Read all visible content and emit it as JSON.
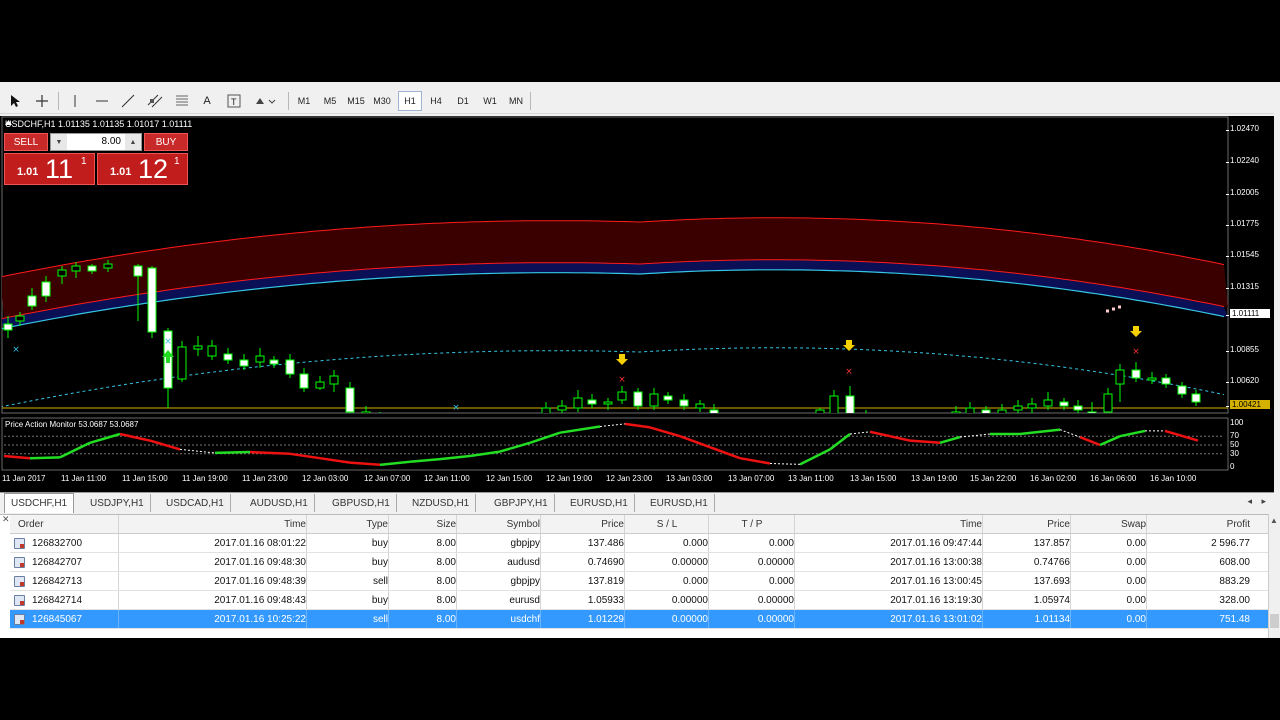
{
  "toolbar": {
    "timeframes": [
      "M1",
      "M5",
      "M15",
      "M30",
      "H1",
      "H4",
      "D1",
      "W1",
      "MN"
    ],
    "active_timeframe": "H1",
    "tools": [
      "cursor-icon",
      "crosshair-icon",
      "vertical-line-icon",
      "horizontal-line-icon",
      "trendline-icon",
      "channel-icon",
      "fibonacci-icon",
      "text-icon",
      "text-label-icon",
      "shapes-icon"
    ]
  },
  "chart": {
    "symbol_line": "USDCHF,H1  1.01135 1.01135 1.01017 1.01111",
    "indicator_title": "Price Action Monitor 53.0687 53.0687",
    "price_labels": [
      "1.02470",
      "1.02240",
      "1.02005",
      "1.01775",
      "1.01545",
      "1.01315",
      "1.01111",
      "1.00855",
      "1.00620",
      "1.00421"
    ],
    "current_price": "1.01111",
    "bid_line_price": "1.00421",
    "indicator_levels": [
      "100",
      "70",
      "50",
      "30",
      "0"
    ],
    "time_labels": [
      "11 Jan 2017",
      "11 Jan 11:00",
      "11 Jan 15:00",
      "11 Jan 19:00",
      "11 Jan 23:00",
      "12 Jan 03:00",
      "12 Jan 07:00",
      "12 Jan 11:00",
      "12 Jan 15:00",
      "12 Jan 19:00",
      "12 Jan 23:00",
      "13 Jan 03:00",
      "13 Jan 07:00",
      "13 Jan 11:00",
      "13 Jan 15:00",
      "13 Jan 19:00",
      "15 Jan 22:00",
      "16 Jan 02:00",
      "16 Jan 06:00",
      "16 Jan 10:00"
    ],
    "colors": {
      "up": "#00ff00",
      "down": "#ffffff",
      "band_fill": "#3a0000",
      "outer_band": "#ff1a1a",
      "inner_band": "#1a2aff",
      "mid_band": "#34c6e6",
      "osc_up": "#22dd22",
      "osc_down": "#ee1111"
    }
  },
  "oneclick": {
    "sell_label": "SELL",
    "buy_label": "BUY",
    "volume": "8.00",
    "sell_price_small": "1.01",
    "sell_price_big": "11",
    "sell_price_sup": "1",
    "buy_price_small": "1.01",
    "buy_price_big": "12",
    "buy_price_sup": "1"
  },
  "symbol_tabs": [
    "USDCHF,H1",
    "USDJPY,H1",
    "USDCAD,H1",
    "AUDUSD,H1",
    "GBPUSD,H1",
    "NZDUSD,H1",
    "GBPJPY,H1",
    "EURUSD,H1",
    "EURUSD,H1"
  ],
  "active_symbol_tab": "USDCHF,H1",
  "orders": {
    "headers": [
      "Order",
      "Time",
      "Type",
      "Size",
      "Symbol",
      "Price",
      "S / L",
      "T / P",
      "Time",
      "Price",
      "Swap",
      "Profit"
    ],
    "rows": [
      [
        "126832700",
        "2017.01.16 08:01:22",
        "buy",
        "8.00",
        "gbpjpy",
        "137.486",
        "0.000",
        "0.000",
        "2017.01.16 09:47:44",
        "137.857",
        "0.00",
        "2 596.77"
      ],
      [
        "126842707",
        "2017.01.16 09:48:30",
        "buy",
        "8.00",
        "audusd",
        "0.74690",
        "0.00000",
        "0.00000",
        "2017.01.16 13:00:38",
        "0.74766",
        "0.00",
        "608.00"
      ],
      [
        "126842713",
        "2017.01.16 09:48:39",
        "sell",
        "8.00",
        "gbpjpy",
        "137.819",
        "0.000",
        "0.000",
        "2017.01.16 13:00:45",
        "137.693",
        "0.00",
        "883.29"
      ],
      [
        "126842714",
        "2017.01.16 09:48:43",
        "buy",
        "8.00",
        "eurusd",
        "1.05933",
        "0.00000",
        "0.00000",
        "2017.01.16 13:19:30",
        "1.05974",
        "0.00",
        "328.00"
      ],
      [
        "126845067",
        "2017.01.16 10:25:22",
        "sell",
        "8.00",
        "usdchf",
        "1.01229",
        "0.00000",
        "0.00000",
        "2017.01.16 13:01:02",
        "1.01134",
        "0.00",
        "751.48"
      ]
    ],
    "selected_row": 4
  }
}
